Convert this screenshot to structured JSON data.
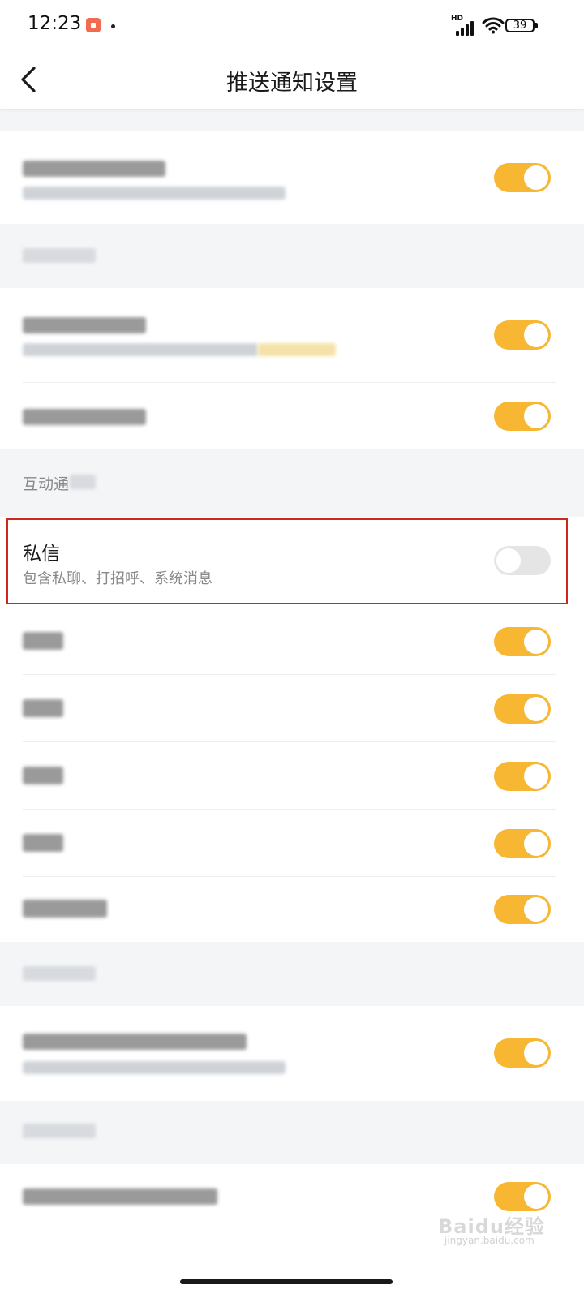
{
  "status_bar": {
    "time": "12:23",
    "network_label": "HD",
    "battery_level": "39"
  },
  "header": {
    "title": "推送通知设置"
  },
  "sections": {
    "interaction": {
      "label": "互动通"
    }
  },
  "private_message": {
    "title": "私信",
    "description": "包含私聊、打招呼、系统消息",
    "enabled": false
  },
  "toggles": {
    "push_all": true,
    "content_update": true,
    "account_info": true,
    "private_message": false,
    "item_5": true,
    "item_6": true,
    "item_7": true,
    "item_8": true,
    "item_9": true,
    "other_item": true,
    "last_item": true
  },
  "watermark": {
    "brand": "Baidu经验",
    "domain": "jingyan.baidu.com"
  },
  "colors": {
    "toggle_on": "#f7b733",
    "toggle_off": "#e5e5e5",
    "highlight": "#d0261c",
    "background": "#f4f5f7"
  }
}
